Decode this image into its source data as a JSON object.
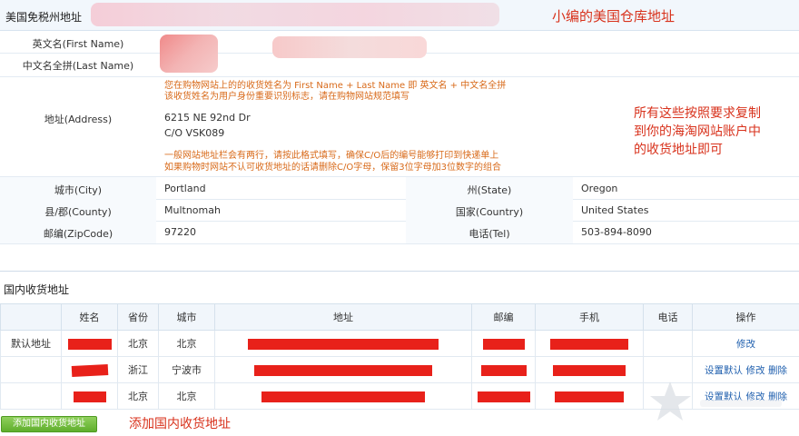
{
  "us_address": {
    "section_title": "美国免税州地址",
    "labels": {
      "first_name": "英文名(First Name)",
      "last_name": "中文名全拼(Last Name)",
      "address": "地址(Address)",
      "city": "城市(City)",
      "state": "州(State)",
      "county": "县/郡(County)",
      "country": "国家(Country)",
      "zip": "邮编(ZipCode)",
      "tel": "电话(Tel)"
    },
    "name_hint_1": "您在购物网站上的的收货姓名为 First Name + Last Name 即 英文名 + 中文名全拼",
    "name_hint_2": "该收货姓名为用户身份重要识别标志，请在购物网站规范填写",
    "address_line_1": "6215 NE 92nd Dr",
    "address_line_2": "C/O VSK089",
    "address_hint_1": "一般网站地址栏会有两行，请按此格式填写，确保C/O后的编号能够打印到快递单上",
    "address_hint_2": "如果购物时网站不认可收货地址的话请删除C/O字母，保留3位字母加3位数字的组合",
    "city": "Portland",
    "state": "Oregon",
    "county": "Multnomah",
    "country": "United States",
    "zip": "97220",
    "tel": "503-894-8090"
  },
  "annotations": {
    "warehouse": "小编的美国仓库地址",
    "copy_note_1": "所有这些按照要求复制",
    "copy_note_2": "到你的海淘网站账户中",
    "copy_note_3": "的收货地址即可",
    "add_domestic": "添加国内收货地址"
  },
  "domestic": {
    "section_title": "国内收货地址",
    "columns": [
      "",
      "姓名",
      "省份",
      "城市",
      "地址",
      "邮编",
      "手机",
      "电话",
      "操作"
    ],
    "rows": [
      {
        "tag": "默认地址",
        "province": "北京",
        "city": "北京",
        "ops": [
          "修改"
        ]
      },
      {
        "tag": "",
        "province": "浙江",
        "city": "宁波市",
        "ops": [
          "设置默认",
          "修改",
          "删除"
        ]
      },
      {
        "tag": "",
        "province": "北京",
        "city": "北京",
        "ops": [
          "设置默认",
          "修改",
          "删除"
        ]
      }
    ],
    "add_button": "添加国内收货地址"
  },
  "colors": {
    "accent_red": "#d8321c",
    "redaction": "#e8211a",
    "hint_orange": "#d86a1a",
    "link_blue": "#1f5fae",
    "button_green": "#5fae2c",
    "header_bg": "#f1f6fb"
  }
}
